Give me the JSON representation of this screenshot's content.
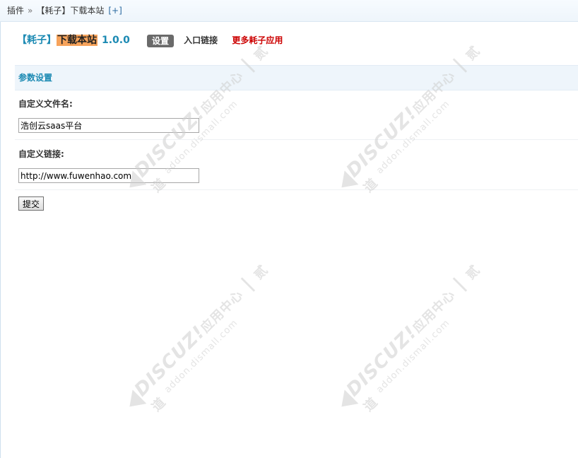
{
  "breadcrumb": {
    "root": "插件",
    "separator": "»",
    "current": "【耗子】下载本站",
    "add": "[+]"
  },
  "header": {
    "title_prefix": "【耗子】",
    "title_highlight": "下载本站",
    "version": "1.0.0",
    "tabs": [
      "设置",
      "入口链接"
    ],
    "more_link": "更多耗子应用"
  },
  "section": {
    "title": "参数设置"
  },
  "form": {
    "fields": [
      {
        "label": "自定义文件名:",
        "value": "浩创云saas平台"
      },
      {
        "label": "自定义链接:",
        "value": "http://www.fuwenhao.com"
      }
    ],
    "submit_label": "提交"
  },
  "watermark": {
    "brand": "DISCUZ!",
    "brand_cn": "应用中心",
    "partner": "贰道",
    "url": "addon.dismall.com"
  },
  "colors": {
    "accent": "#1c8ab3",
    "highlight": "#f7a35b",
    "more_link": "#cc0000",
    "section_bg": "#eef5fb"
  }
}
